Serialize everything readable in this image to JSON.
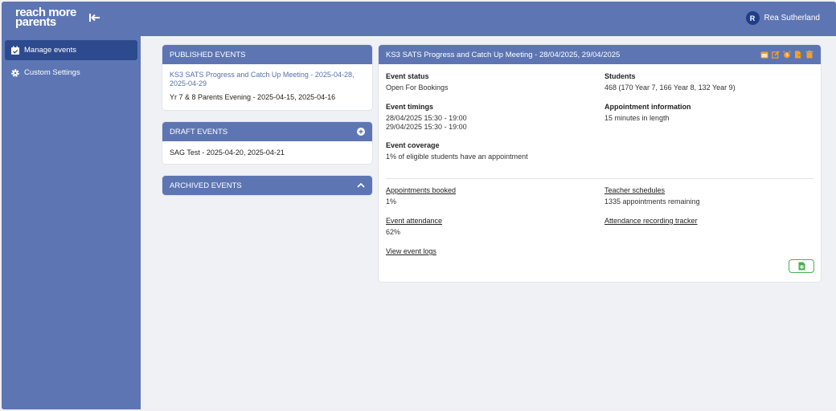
{
  "app": {
    "logo_line1": "reach more",
    "logo_line2": "parents",
    "user_initial": "R",
    "user_name": "Rea Sutherland"
  },
  "sidebar": {
    "items": [
      {
        "label": "Manage events",
        "icon": "calendar-check-icon",
        "active": true
      },
      {
        "label": "Custom Settings",
        "icon": "gear-icon",
        "active": false
      }
    ]
  },
  "published": {
    "title": "PUBLISHED EVENTS",
    "events": [
      {
        "name": "KS3 SATS Progress and Catch Up Meeting",
        "dates": " - 2025-04-28, 2025-04-29"
      },
      {
        "name": "Yr 7 & 8 Parents Evening",
        "dates": " - 2025-04-15, 2025-04-16"
      }
    ]
  },
  "drafts": {
    "title": "DRAFT EVENTS",
    "events": [
      {
        "name": "SAG Test",
        "dates": " - 2025-04-20, 2025-04-21"
      }
    ]
  },
  "archived": {
    "title": "ARCHIVED EVENTS"
  },
  "detail": {
    "title": "KS3 SATS Progress and Catch Up Meeting - 28/04/2025, 29/04/2025",
    "header_icons": [
      "calendar-icon",
      "edit-icon",
      "alarm-icon",
      "export-icon",
      "trash-icon"
    ],
    "event_status_label": "Event status",
    "event_status_value": "Open For Bookings",
    "students_label": "Students",
    "students_value": "468 (170 Year 7, 166 Year 8, 132 Year 9)",
    "timings_label": "Event timings",
    "timings_line1": "28/04/2025 15:30 - 19:00",
    "timings_line2": "29/04/2025 15:30 - 19:00",
    "appt_info_label": "Appointment information",
    "appt_info_value": "15 minutes in length",
    "coverage_label": "Event coverage",
    "coverage_value": "1% of eligible students have an appointment",
    "appointments_booked_link": "Appointments booked",
    "appointments_booked_value": "1%",
    "teacher_schedules_link": "Teacher schedules",
    "teacher_schedules_value": "1335 appointments remaining",
    "attendance_link": "Event attendance",
    "attendance_value": "62%",
    "attendance_tracker_link": "Attendance recording tracker",
    "event_logs_link": "View event logs"
  },
  "colors": {
    "brand": "#5d76b3",
    "nav_active": "#2e4a8f",
    "icon_orange": "#f0a030",
    "green": "#4caf50"
  }
}
